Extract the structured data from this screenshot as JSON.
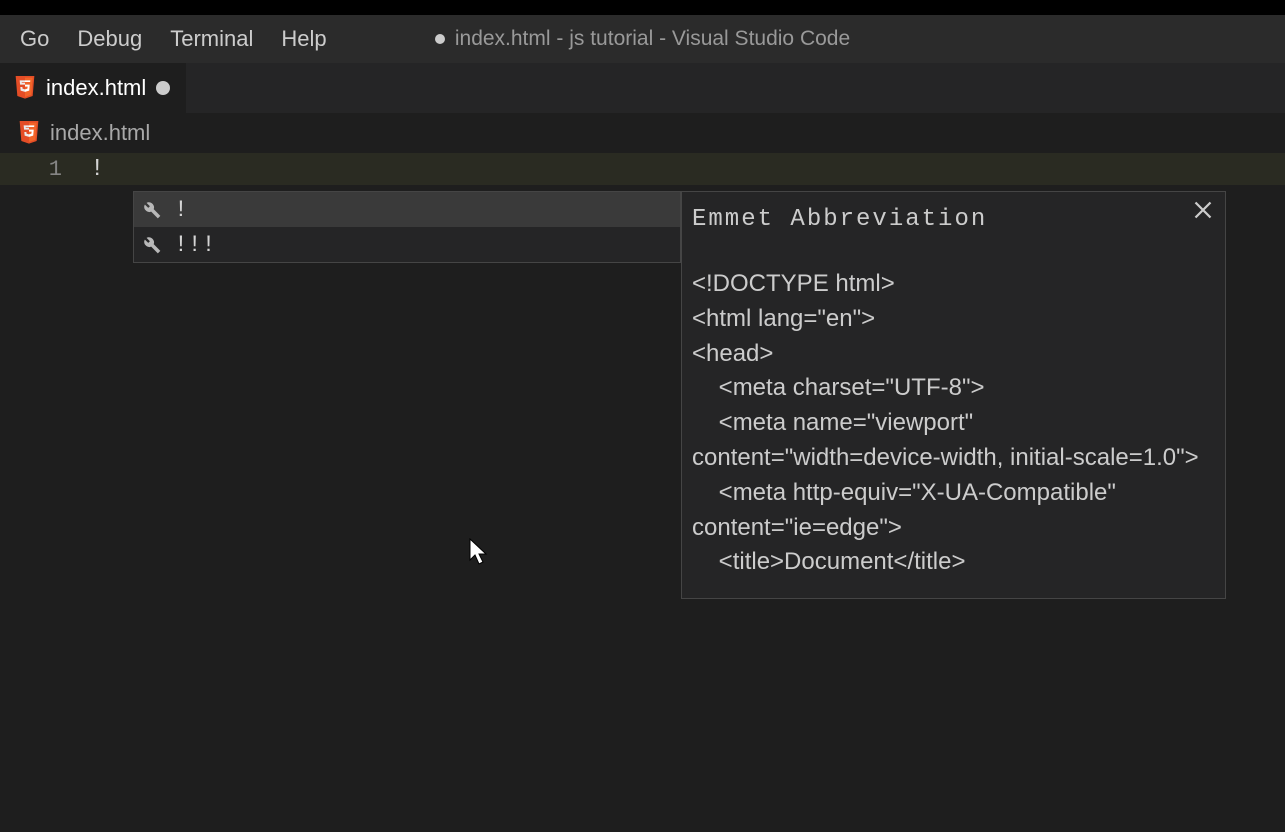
{
  "menubar": {
    "items": [
      "Go",
      "Debug",
      "Terminal",
      "Help"
    ]
  },
  "titlebar": {
    "modified": true,
    "text": "index.html - js tutorial - Visual Studio Code"
  },
  "tab": {
    "icon": "html5-icon",
    "title": "index.html",
    "modified": true
  },
  "breadcrumb": {
    "icon": "html5-icon",
    "text": "index.html"
  },
  "editor": {
    "line_number": "1",
    "content": "!"
  },
  "suggestions": {
    "items": [
      {
        "icon": "wrench-icon",
        "label": "!",
        "selected": true
      },
      {
        "icon": "wrench-icon",
        "label": "!!!",
        "selected": false
      }
    ]
  },
  "documentation": {
    "title": "Emmet Abbreviation",
    "body": "<!DOCTYPE html>\n<html lang=\"en\">\n<head>\n    <meta charset=\"UTF-8\">\n    <meta name=\"viewport\" content=\"width=device-width, initial-scale=1.0\">\n    <meta http-equiv=\"X-UA-Compatible\" content=\"ie=edge\">\n    <title>Document</title>"
  }
}
